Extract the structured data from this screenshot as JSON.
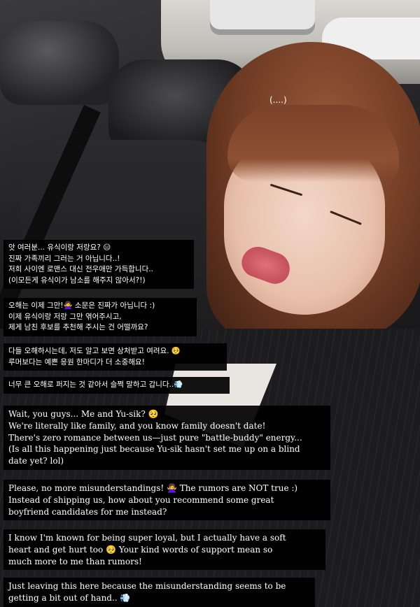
{
  "overlay": {
    "ellipsis": "(....)"
  },
  "captions_ko": [
    {
      "lines": [
        "앗 여러분... 유식이랑 저랑요? 😑",
        "진짜 가족끼리 그러는 거 아닙니다..!",
        "저희 사이엔 로맨스 대신 전우애만 가득합니다..",
        "(이모든게 유식이가 남소를 해주지 않아서?!)"
      ]
    },
    {
      "lines": [
        "오해는 이제 그만!🙅‍♀️ 소문은 진짜가 아닙니다 :)",
        "이제 유식이랑 저랑 그만 엮어주시고,",
        "제게 남친 후보를 추천해 주시는 건 어떨까요?"
      ]
    },
    {
      "lines": [
        "다들 오해하시는데, 저도 알고 보면 상처받고 여려요. 🥺",
        "루머보다는 예쁜 응원 한마디가 더 소중해요!"
      ]
    },
    {
      "lines": [
        "너무 큰 오해로 퍼지는 것 같아서 슬쩍 말하고 갑니다..💨"
      ]
    }
  ],
  "captions_en": [
    {
      "lines": [
        "Wait, you guys... Me and Yu-sik? 🥺",
        "We're literally like family, and you know family doesn't date!",
        "There's zero romance between us—just pure \"battle-buddy\" energy...",
        "(Is all this happening just because Yu-sik hasn't set me up on a blind",
        "date yet? lol)"
      ]
    },
    {
      "lines": [
        "Please, no more misunderstandings! 🙅‍♀️ The rumors are NOT true :)",
        "Instead of shipping us, how about you recommend some great",
        "boyfriend candidates for me instead?"
      ]
    },
    {
      "lines": [
        "I know I'm known for being super loyal, but I actually have a soft",
        "heart and get hurt too 🥺 Your kind words of support mean so",
        "much more to me than rumors!"
      ]
    },
    {
      "lines": [
        "Just leaving this here because the misunderstanding seems to be",
        "getting a bit out of hand.. 💨"
      ]
    }
  ]
}
